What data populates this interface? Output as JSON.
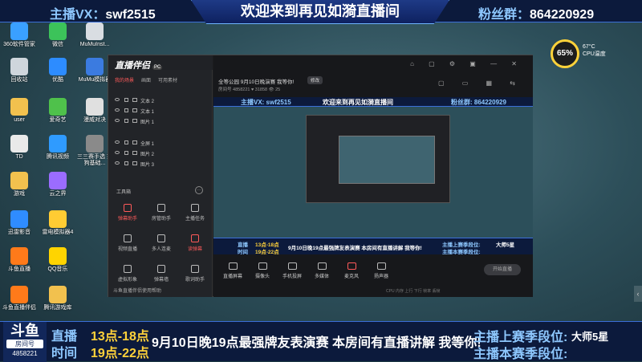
{
  "top_banner": {
    "left_label": "主播VX：",
    "left_value": "swf2515",
    "center_title": "欢迎来到再见如漪直播间",
    "right_label": "粉丝群：",
    "right_value": "864220929"
  },
  "desktop_icons": [
    {
      "label": "360软件管家",
      "color": "#3aa0ff"
    },
    {
      "label": "微信",
      "color": "#3cc35a"
    },
    {
      "label": "MuMuInst...",
      "color": "#d9dde2"
    },
    {
      "label": "回收站",
      "color": "#cfd6dc"
    },
    {
      "label": "优酷",
      "color": "#2d8cff"
    },
    {
      "label": "MuMu模拟器",
      "color": "#3b7be0"
    },
    {
      "label": "user",
      "color": "#f2c14e"
    },
    {
      "label": "爱奇艺",
      "color": "#4fc14b"
    },
    {
      "label": "漫威对决",
      "color": "#e0e0e0"
    },
    {
      "label": "TD",
      "color": "#e9e9e9"
    },
    {
      "label": "腾讯视频",
      "color": "#2f9bff"
    },
    {
      "label": "三三赛手选 搜狗基础...",
      "color": "#8a8a8a"
    },
    {
      "label": "游戏",
      "color": "#f2c14e"
    },
    {
      "label": "云之界",
      "color": "#9b6cff"
    },
    {
      "label": "迅雷影音",
      "color": "#2f8cff"
    },
    {
      "label": "雷电模拟器4",
      "color": "#ffcc33"
    },
    {
      "label": "斗鱼直播",
      "color": "#ff7a1a"
    },
    {
      "label": "QQ音乐",
      "color": "#ffd400"
    },
    {
      "label": "斗鱼直播伴侣",
      "color": "#ff7a1a"
    },
    {
      "label": "腾讯游戏库",
      "color": "#f2c14e"
    }
  ],
  "gauge": {
    "percent_text": "65%",
    "temp_text": "67°C",
    "temp_label": "CPU温度"
  },
  "obs": {
    "logo": "直播伴侣",
    "logo_tag": "PC",
    "tabs": [
      "我的场景",
      "画面",
      "可用素材"
    ],
    "layers": [
      "文本 2",
      "文本 1",
      "图片 1",
      "全屏 1",
      "图片 2",
      "图片 3"
    ],
    "tools_title": "工具箱",
    "tools_more": "···",
    "tools": [
      {
        "label": "弹幕助手",
        "active": true
      },
      {
        "label": "房管助手",
        "active": false
      },
      {
        "label": "主播任务",
        "active": false
      },
      {
        "label": "视频直播",
        "active": false
      },
      {
        "label": "多人连麦",
        "active": false
      },
      {
        "label": "读弹幕",
        "active": true
      },
      {
        "label": "虚拟形象",
        "active": false
      },
      {
        "label": "弹幕墙",
        "active": false
      },
      {
        "label": "歌词助手",
        "active": false
      }
    ],
    "left_footer": "斗鱼直播伴侣使用帮助",
    "room_title": "全等公园 9月10日晚演赛 我等你!",
    "room_button": "修改",
    "room_sub": "房间号 4858221   ♥ 31858   👁 25",
    "preview_top_left": "主播VX: swf2515",
    "preview_top_center": "欢迎来到再见如漪直播间",
    "preview_top_right": "粉丝群: 864220929",
    "preview_bottom": {
      "sched_a_label": "直播",
      "sched_a_value": "13点-18点",
      "sched_b_label": "时间",
      "sched_b_value": "19点-22点",
      "msg": "9月10日晚19点最强牌友表演赛 本房间有直播讲解 我等你!",
      "rank_a_label": "主播上赛季段位:",
      "rank_a_value": "大师5星",
      "rank_b_label": "主播本赛季段位:"
    },
    "controls": [
      {
        "label": "直播屏幕",
        "red": false
      },
      {
        "label": "摄像头",
        "red": false
      },
      {
        "label": "手机投屏",
        "red": false
      },
      {
        "label": "多媒体",
        "red": false
      },
      {
        "label": "麦克风",
        "red": true
      },
      {
        "label": "扬声器",
        "red": false
      }
    ],
    "start_button": "开始直播",
    "status_row": "CPU  内存  上行  下行  帧率  丢帧"
  },
  "bottom_banner": {
    "logo_big": "斗鱼",
    "logo_tag": "房间号",
    "room_number": "4858221",
    "sched_a_label": "直播",
    "sched_a_value": "13点-18点",
    "sched_b_label": "时间",
    "sched_b_value": "19点-22点",
    "message": "9月10日晚19点最强牌友表演赛 本房间有直播讲解 我等你!",
    "rank_a_label": "主播上赛季段位:",
    "rank_a_value": "大师5星",
    "rank_b_label": "主播本赛季段位:",
    "rank_b_value": ""
  }
}
